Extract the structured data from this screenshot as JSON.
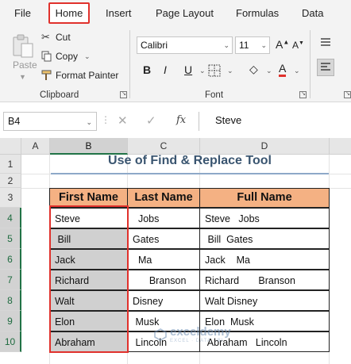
{
  "tabs": [
    "File",
    "Home",
    "Insert",
    "Page Layout",
    "Formulas",
    "Data"
  ],
  "active_tab": "Home",
  "ribbon": {
    "clipboard": {
      "paste_label": "Paste",
      "cut_label": "Cut",
      "copy_label": "Copy",
      "format_painter_label": "Format Painter",
      "group_label": "Clipboard"
    },
    "font": {
      "font_name": "Calibri",
      "font_size": "11",
      "bold": "B",
      "italic": "I",
      "underline": "U",
      "font_color_glyph": "A",
      "group_label": "Font"
    }
  },
  "formula_bar": {
    "name_box": "B4",
    "fx": "fx",
    "value": "Steve"
  },
  "columns": [
    "A",
    "B",
    "C",
    "D"
  ],
  "rows": [
    "1",
    "2",
    "3",
    "4",
    "5",
    "6",
    "7",
    "8",
    "9",
    "10"
  ],
  "sheet": {
    "title": "Use of Find & Replace Tool",
    "headers": [
      "First Name",
      "Last Name",
      "Full Name"
    ],
    "data": [
      [
        "Steve",
        "  Jobs",
        "Steve   Jobs"
      ],
      [
        " Bill",
        "Gates",
        " Bill  Gates"
      ],
      [
        "Jack",
        "  Ma",
        "Jack    Ma"
      ],
      [
        "Richard",
        "      Branson",
        "Richard       Branson"
      ],
      [
        "Walt",
        "Disney",
        "Walt Disney"
      ],
      [
        "Elon",
        " Musk",
        "Elon  Musk"
      ],
      [
        "Abraham",
        " Lincoln",
        " Abraham   Lincoln"
      ]
    ]
  },
  "watermark": {
    "name": "exceldemy",
    "sub": "EXCEL · DATA · BI"
  },
  "colors": {
    "header_fill": "#f4b183",
    "selection_red": "#e0312c",
    "excel_green": "#217346"
  }
}
